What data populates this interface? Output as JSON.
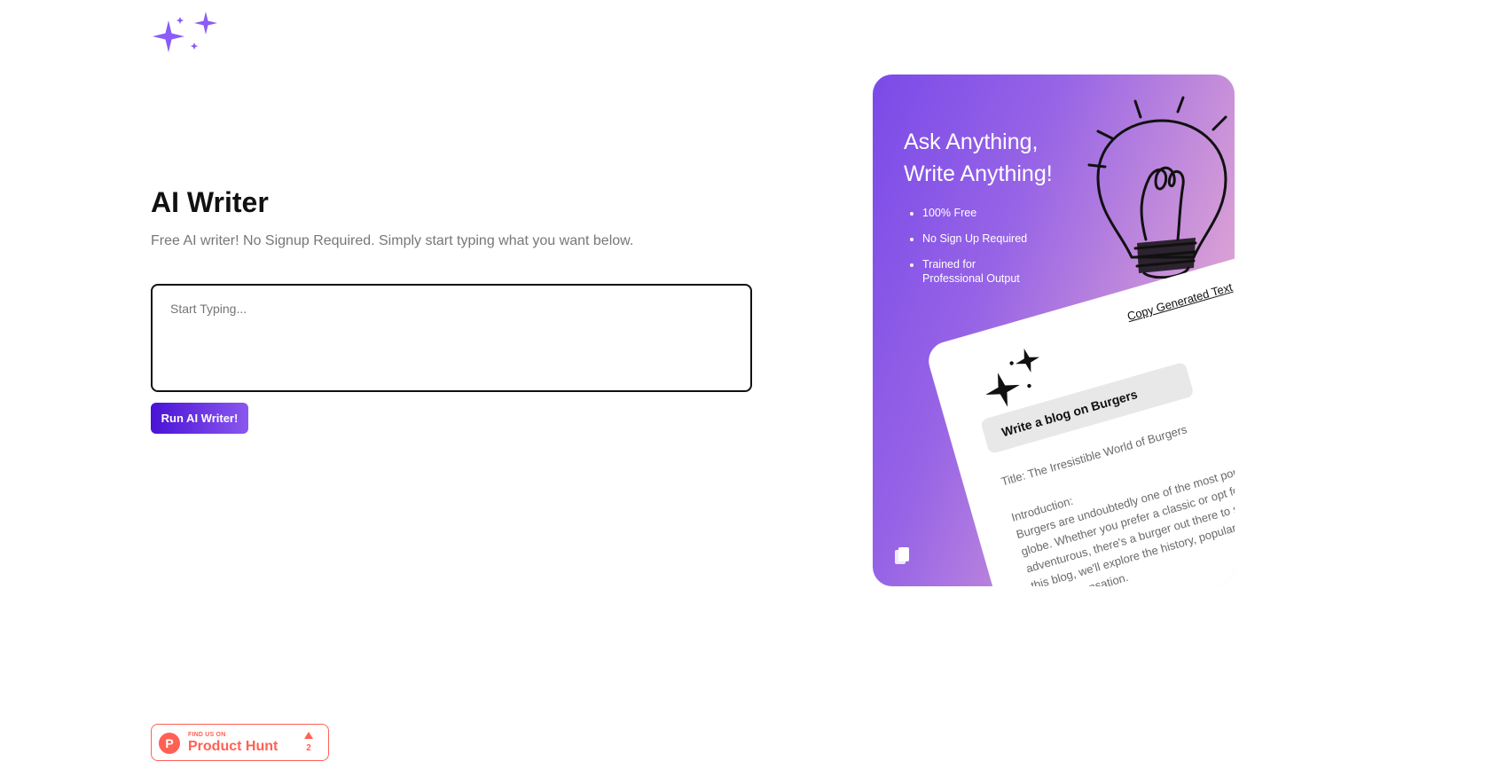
{
  "header": {
    "logo_icon": "sparkles-icon",
    "logo_color": "#8b5cf6"
  },
  "main": {
    "title": "AI Writer",
    "subtitle": "Free AI writer! No Signup Required. Simply start typing what you want below.",
    "input": {
      "placeholder": "Start Typing...",
      "value": ""
    },
    "run_button_label": "Run AI Writer!",
    "accent_colors": [
      "#4a12d6",
      "#8a58ee"
    ]
  },
  "promo": {
    "heading_line1": "Ask Anything,",
    "heading_line2": "Write Anything!",
    "features": [
      "100% Free",
      "No Sign Up Required",
      "Trained for Professional Output"
    ],
    "bulb_icon": "lightbulb-icon",
    "card": {
      "copy_label": "Copy Generated Text",
      "sparkle_icon": "sparkles-icon",
      "prompt": "Write a blog on Burgers",
      "title_line": "Title: The Irresistible World of Burgers",
      "intro_label": "Introduction:",
      "intro_text": "Burgers are undoubtedly one of the most popular foods across the globe. Whether you prefer a classic or opt for something more adventurous, there's a burger out there to satisfy every craving. In this blog, we'll explore the history, popularity, and appeal of this culinary sensation."
    },
    "copy_icon": "copy-icon"
  },
  "badge": {
    "small_text": "FIND US ON",
    "name": "Product Hunt",
    "logo_letter": "P",
    "upvote_icon": "upvote-arrow-icon",
    "count": "2",
    "color": "#ff6154"
  }
}
